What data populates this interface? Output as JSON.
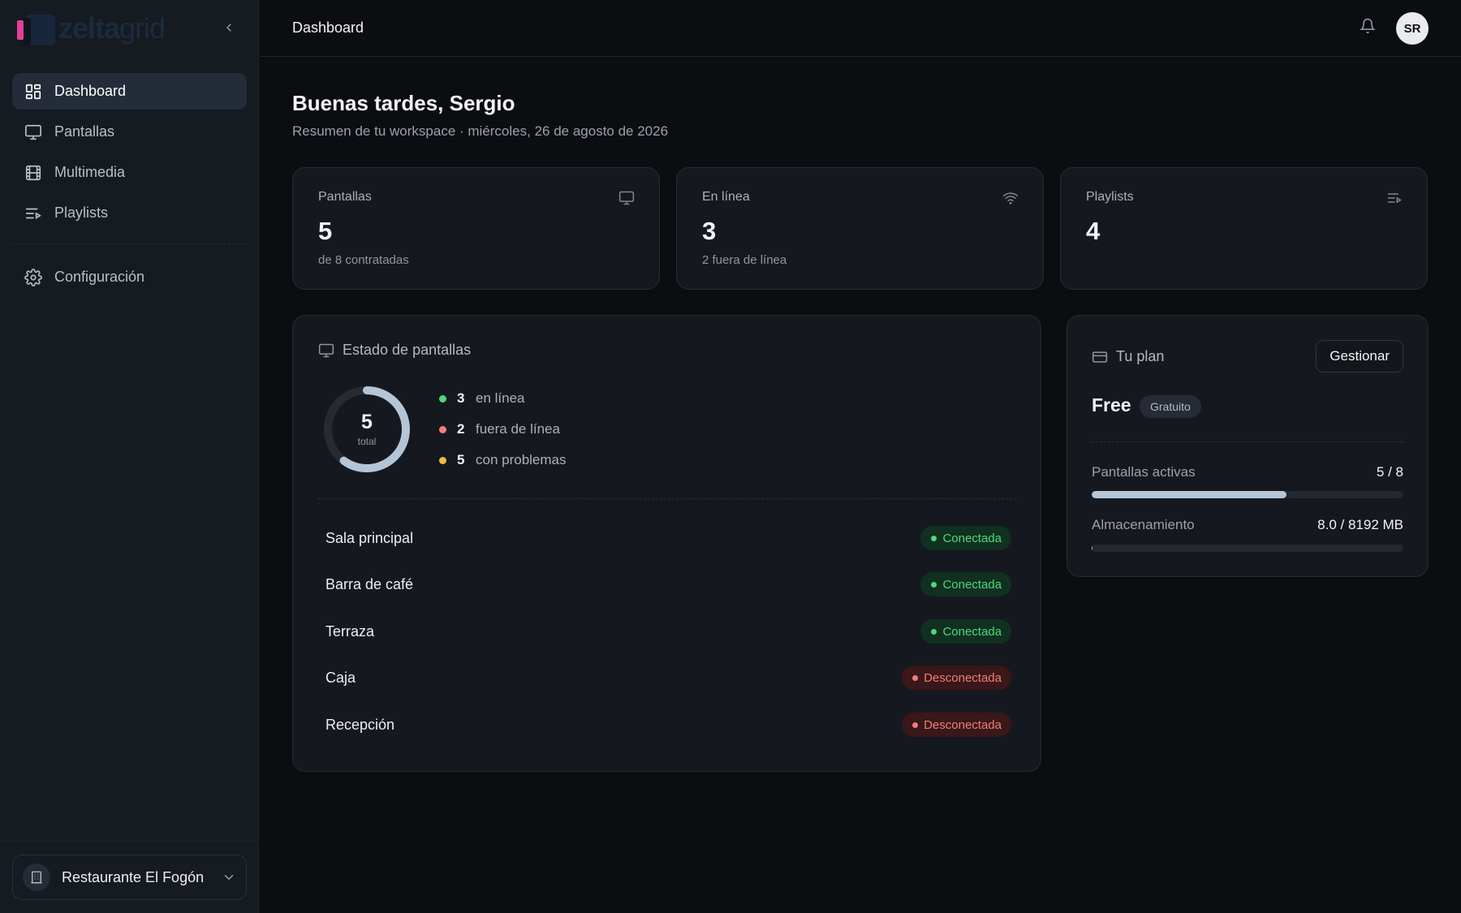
{
  "sidebar": {
    "logo_text_bold": "zelta",
    "logo_text_light": "grid",
    "items": [
      {
        "label": "Dashboard"
      },
      {
        "label": "Pantallas"
      },
      {
        "label": "Multimedia"
      },
      {
        "label": "Playlists"
      },
      {
        "label": "Configuración"
      }
    ],
    "workspace": "Restaurante El Fogón"
  },
  "header": {
    "title": "Dashboard",
    "avatar_initials": "SR"
  },
  "main": {
    "greeting": "Buenas tardes, Sergio",
    "subtitle": "Resumen de tu workspace · miércoles, 26 de agosto de 2026",
    "stats": [
      {
        "label": "Pantallas",
        "value": "5",
        "sub": "de 8 contratadas"
      },
      {
        "label": "En línea",
        "value": "3",
        "sub": "2 fuera de línea"
      },
      {
        "label": "Playlists",
        "value": "4",
        "sub": ""
      }
    ],
    "screens_panel": {
      "title": "Estado de pantallas",
      "total": "5",
      "total_label": "total",
      "online_fraction": 0.6,
      "legend": [
        {
          "count": "3",
          "label": "en línea",
          "color": "#4cd97b"
        },
        {
          "count": "2",
          "label": "fuera de línea",
          "color": "#f07e78"
        },
        {
          "count": "5",
          "label": "con problemas",
          "color": "#f5b942"
        }
      ],
      "screens": [
        {
          "name": "Sala principal",
          "status": "Conectada"
        },
        {
          "name": "Barra de café",
          "status": "Conectada"
        },
        {
          "name": "Terraza",
          "status": "Conectada"
        },
        {
          "name": "Caja",
          "status": "Desconectada"
        },
        {
          "name": "Recepción",
          "status": "Desconectada"
        }
      ]
    },
    "plan_panel": {
      "title": "Tu plan",
      "manage_label": "Gestionar",
      "plan_name": "Free",
      "plan_badge": "Gratuito",
      "usage": [
        {
          "label": "Pantallas activas",
          "value": "5 / 8",
          "fraction": 0.625
        },
        {
          "label": "Almacenamiento",
          "value": "8.0 / 8192 MB",
          "fraction": 0.001
        }
      ]
    }
  },
  "colors": {
    "accent": "#b5c5d8",
    "online": "#4cd97b",
    "offline": "#f07e78",
    "warning": "#f5b942",
    "brand_pink": "#e0409a"
  }
}
